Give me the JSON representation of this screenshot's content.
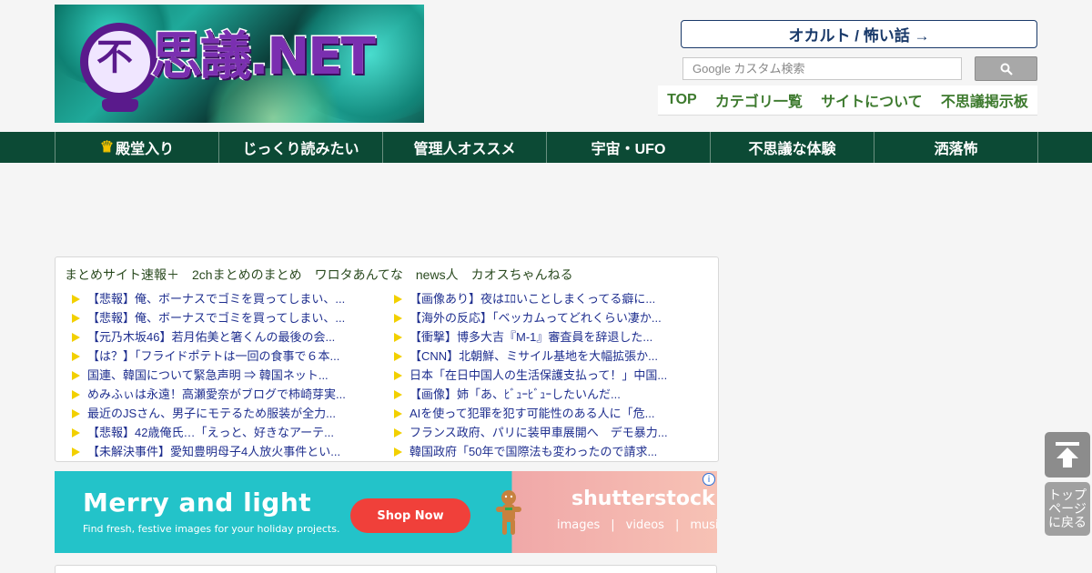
{
  "header": {
    "logo_text": "思議.NET",
    "logo_glyph": "不",
    "occult_button": "オカルト / 怖い話 →",
    "search": {
      "placeholder": "Google カスタム検索"
    },
    "top_nav": [
      "TOP",
      "カテゴリ一覧",
      "サイトについて",
      "不思議掲示板"
    ],
    "colors": {
      "nav_green": "#0c4a35",
      "link_green": "#3d7a2e",
      "link_blue": "#1f2f8f"
    }
  },
  "main_nav": [
    {
      "icon": "crown-icon",
      "label": "殿堂入り"
    },
    {
      "label": "じっくり読みたい"
    },
    {
      "label": "管理人オススメ"
    },
    {
      "label": "宇宙・UFO"
    },
    {
      "label": "不思議な体験"
    },
    {
      "label": "洒落怖"
    }
  ],
  "feed": {
    "sources": [
      "まとめサイト速報＋",
      "2chまとめのまとめ",
      "ワロタあんてな",
      "news人",
      "カオスちゃんねる"
    ],
    "left": [
      "【悲報】俺、ボーナスでゴミを買ってしまい、...",
      "【悲報】俺、ボーナスでゴミを買ってしまい、...",
      "【元乃木坂46】若月佑美と箸くんの最後の会...",
      "【は？】「フライドポテトは一回の食事で６本...",
      "国連、韓国について緊急声明 ⇒ 韓国ネット...",
      "めみふぃは永遠！高瀬愛奈がブログで柿崎芽実...",
      "最近のJSさん、男子にモテるため服装が全力...",
      "【悲報】42歳俺氏…「えっと、好きなアーテ...",
      "【未解決事件】愛知豊明母子4人放火事件とい..."
    ],
    "right": [
      "【画像あり】夜はｴﾛいことしまくってる癖に...",
      "【海外の反応】「ベッカムってどれくらい凄か...",
      "【衝撃】博多大吉『M-1』審査員を辞退した...",
      "【CNN】北朝鮮、ミサイル基地を大幅拡張か...",
      "日本「在日中国人の生活保護支払って！」中国...",
      "【画像】姉「あ、ﾋﾞｭｰﾋﾞｭｰしたいんだ...",
      "AIを使って犯罪を犯す可能性のある人に「危...",
      "フランス政府、パリに装甲車展開へ　デモ暴力...",
      "韓国政府「50年で国際法も変わったので請求..."
    ]
  },
  "ad": {
    "headline": "Merry and light",
    "sub": "Find fresh, festive images for your holiday projects.",
    "cta": "Shop Now",
    "brand": "shutterstock",
    "media": [
      "images",
      "|",
      "videos",
      "|",
      "music"
    ],
    "info": "i"
  },
  "back_to_top": {
    "label_lines": [
      "トップ",
      "ページ",
      "に戻る"
    ]
  }
}
